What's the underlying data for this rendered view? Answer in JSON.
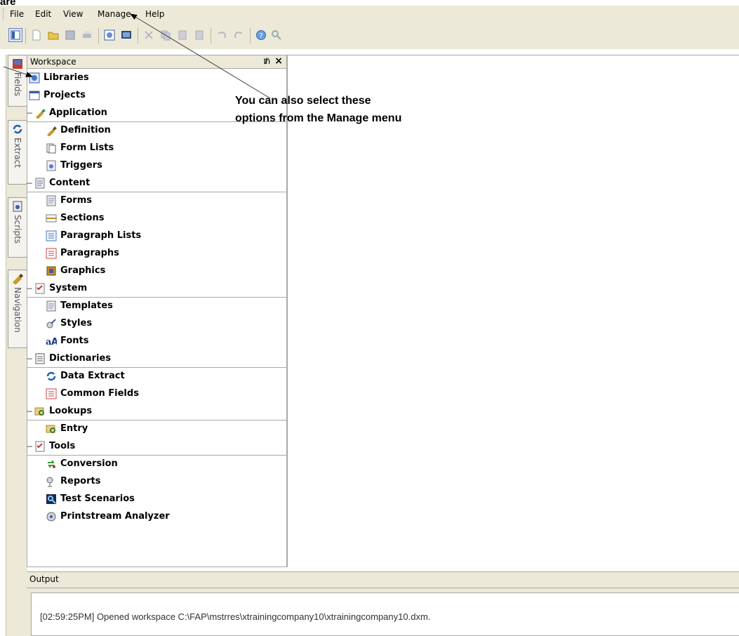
{
  "callout_top": "are",
  "menu": [
    "File",
    "Edit",
    "View",
    "Manage",
    "Help"
  ],
  "toolbar_icons": [
    "workspace-panel",
    "new",
    "open",
    "save",
    "print",
    "fields-view",
    "screen-view",
    "cut",
    "copy",
    "paste",
    "paste-special",
    "undo",
    "redo",
    "help",
    "find"
  ],
  "workspace": {
    "title": "Workspace",
    "pin": "ѱ",
    "close": "×",
    "items": [
      {
        "type": "item",
        "label": "Libraries",
        "icon": "libraries-icon"
      },
      {
        "type": "item",
        "label": "Projects",
        "icon": "projects-icon"
      },
      {
        "type": "category",
        "label": "Application",
        "icon": "application-icon"
      },
      {
        "type": "item",
        "label": "Definition",
        "icon": "definition-icon"
      },
      {
        "type": "item",
        "label": "Form Lists",
        "icon": "form-lists-icon"
      },
      {
        "type": "item",
        "label": "Triggers",
        "icon": "triggers-icon"
      },
      {
        "type": "category",
        "label": "Content",
        "icon": "content-icon"
      },
      {
        "type": "item",
        "label": "Forms",
        "icon": "forms-icon"
      },
      {
        "type": "item",
        "label": "Sections",
        "icon": "sections-icon"
      },
      {
        "type": "item",
        "label": "Paragraph Lists",
        "icon": "paragraph-lists-icon"
      },
      {
        "type": "item",
        "label": "Paragraphs",
        "icon": "paragraphs-icon"
      },
      {
        "type": "item",
        "label": "Graphics",
        "icon": "graphics-icon"
      },
      {
        "type": "category",
        "label": "System",
        "icon": "system-icon"
      },
      {
        "type": "item",
        "label": "Templates",
        "icon": "templates-icon"
      },
      {
        "type": "item",
        "label": "Styles",
        "icon": "styles-icon"
      },
      {
        "type": "item",
        "label": "Fonts",
        "icon": "fonts-icon"
      },
      {
        "type": "category",
        "label": "Dictionaries",
        "icon": "dictionaries-icon"
      },
      {
        "type": "item",
        "label": "Data Extract",
        "icon": "data-extract-icon"
      },
      {
        "type": "item",
        "label": "Common Fields",
        "icon": "common-fields-icon"
      },
      {
        "type": "category",
        "label": "Lookups",
        "icon": "lookups-icon"
      },
      {
        "type": "item",
        "label": "Entry",
        "icon": "entry-icon"
      },
      {
        "type": "category",
        "label": "Tools",
        "icon": "tools-icon"
      },
      {
        "type": "item",
        "label": "Conversion",
        "icon": "conversion-icon"
      },
      {
        "type": "item",
        "label": "Reports",
        "icon": "reports-icon"
      },
      {
        "type": "item",
        "label": "Test Scenarios",
        "icon": "test-scenarios-icon"
      },
      {
        "type": "item",
        "label": "Printstream Analyzer",
        "icon": "printstream-analyzer-icon"
      }
    ]
  },
  "side_tabs": [
    {
      "label": "Fields",
      "icon": "fields-tab-icon"
    },
    {
      "label": "Extract",
      "icon": "extract-tab-icon"
    },
    {
      "label": "Scripts",
      "icon": "scripts-tab-icon"
    },
    {
      "label": "Navigation",
      "icon": "navigation-tab-icon"
    }
  ],
  "callout_main": [
    "You can also select these",
    "options from the Manage menu"
  ],
  "output": {
    "title": "Output",
    "line": "[02:59:25PM] Opened workspace C:\\FAP\\mstrres\\xtrainingcompany10\\xtrainingcompany10.dxm."
  },
  "colors": {
    "chrome": "#ece9d8",
    "border": "#a8a8a8"
  }
}
